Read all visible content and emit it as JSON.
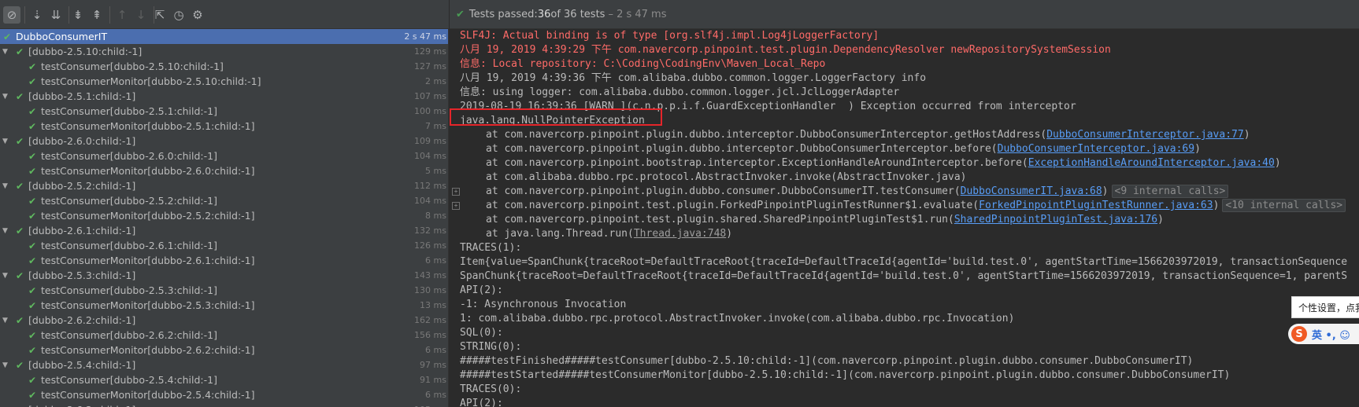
{
  "toolbar": {
    "buttons": [
      {
        "name": "show-passed-toggle",
        "icon": "⊘",
        "active": true
      },
      {
        "name": "sort-alphabetically",
        "icon": "⇣"
      },
      {
        "name": "sort-by-duration",
        "icon": "⇊"
      },
      {
        "name": "expand-all",
        "icon": "⇟"
      },
      {
        "name": "collapse-all",
        "icon": "⇞"
      },
      {
        "name": "previous-failed",
        "icon": "↑",
        "disabled": true
      },
      {
        "name": "next-failed",
        "icon": "↓",
        "disabled": true
      },
      {
        "name": "export",
        "icon": "⇱"
      },
      {
        "name": "history",
        "icon": "◷"
      },
      {
        "name": "settings",
        "icon": "⚙"
      }
    ]
  },
  "status": {
    "prefix": "Tests passed: ",
    "passed": "36",
    "suffix": " of 36 tests",
    "duration": "– 2 s 47 ms"
  },
  "tree": [
    {
      "label": "DubboConsumerIT",
      "duration": "2 s 47 ms",
      "level": 0,
      "selected": true
    },
    {
      "label": "[dubbo-2.5.10:child:-1]",
      "duration": "129 ms",
      "level": 1
    },
    {
      "label": "testConsumer[dubbo-2.5.10:child:-1]",
      "duration": "127 ms",
      "level": 2
    },
    {
      "label": "testConsumerMonitor[dubbo-2.5.10:child:-1]",
      "duration": "2 ms",
      "level": 2
    },
    {
      "label": "[dubbo-2.5.1:child:-1]",
      "duration": "107 ms",
      "level": 1
    },
    {
      "label": "testConsumer[dubbo-2.5.1:child:-1]",
      "duration": "100 ms",
      "level": 2
    },
    {
      "label": "testConsumerMonitor[dubbo-2.5.1:child:-1]",
      "duration": "7 ms",
      "level": 2
    },
    {
      "label": "[dubbo-2.6.0:child:-1]",
      "duration": "109 ms",
      "level": 1
    },
    {
      "label": "testConsumer[dubbo-2.6.0:child:-1]",
      "duration": "104 ms",
      "level": 2
    },
    {
      "label": "testConsumerMonitor[dubbo-2.6.0:child:-1]",
      "duration": "5 ms",
      "level": 2
    },
    {
      "label": "[dubbo-2.5.2:child:-1]",
      "duration": "112 ms",
      "level": 1
    },
    {
      "label": "testConsumer[dubbo-2.5.2:child:-1]",
      "duration": "104 ms",
      "level": 2
    },
    {
      "label": "testConsumerMonitor[dubbo-2.5.2:child:-1]",
      "duration": "8 ms",
      "level": 2
    },
    {
      "label": "[dubbo-2.6.1:child:-1]",
      "duration": "132 ms",
      "level": 1
    },
    {
      "label": "testConsumer[dubbo-2.6.1:child:-1]",
      "duration": "126 ms",
      "level": 2
    },
    {
      "label": "testConsumerMonitor[dubbo-2.6.1:child:-1]",
      "duration": "6 ms",
      "level": 2
    },
    {
      "label": "[dubbo-2.5.3:child:-1]",
      "duration": "143 ms",
      "level": 1
    },
    {
      "label": "testConsumer[dubbo-2.5.3:child:-1]",
      "duration": "130 ms",
      "level": 2
    },
    {
      "label": "testConsumerMonitor[dubbo-2.5.3:child:-1]",
      "duration": "13 ms",
      "level": 2
    },
    {
      "label": "[dubbo-2.6.2:child:-1]",
      "duration": "162 ms",
      "level": 1
    },
    {
      "label": "testConsumer[dubbo-2.6.2:child:-1]",
      "duration": "156 ms",
      "level": 2
    },
    {
      "label": "testConsumerMonitor[dubbo-2.6.2:child:-1]",
      "duration": "6 ms",
      "level": 2
    },
    {
      "label": "[dubbo-2.5.4:child:-1]",
      "duration": "97 ms",
      "level": 1
    },
    {
      "label": "testConsumer[dubbo-2.5.4:child:-1]",
      "duration": "91 ms",
      "level": 2
    },
    {
      "label": "testConsumerMonitor[dubbo-2.5.4:child:-1]",
      "duration": "6 ms",
      "level": 2
    },
    {
      "label": "[dubbo-2.6.3:child:-1]",
      "duration": "105 ms",
      "level": 1
    }
  ],
  "console": [
    {
      "type": "err",
      "text": "SLF4J: Actual binding is of type [org.slf4j.impl.Log4jLoggerFactory]"
    },
    {
      "type": "err",
      "text": "八月 19, 2019 4:39:29 下午 com.navercorp.pinpoint.test.plugin.DependencyResolver newRepositorySystemSession"
    },
    {
      "type": "err",
      "text": "信息: Local repository: C:\\Coding\\CodingEnv\\Maven_Local_Repo"
    },
    {
      "type": "out",
      "text": "八月 19, 2019 4:39:36 下午 com.alibaba.dubbo.common.logger.LoggerFactory info"
    },
    {
      "type": "out",
      "text": "信息: using logger: com.alibaba.dubbo.common.logger.jcl.JclLoggerAdapter"
    },
    {
      "type": "out",
      "text": "2019-08-19 16:39:36 [WARN ](c.n.p.p.i.f.GuardExceptionHandler  ) Exception occurred from interceptor"
    },
    {
      "type": "out",
      "text": "java.lang.NullPointerException"
    },
    {
      "type": "trace",
      "text": "at com.navercorp.pinpoint.plugin.dubbo.interceptor.DubboConsumerInterceptor.getHostAddress(",
      "link": "DubboConsumerInterceptor.java:77",
      "after": ")"
    },
    {
      "type": "trace",
      "text": "at com.navercorp.pinpoint.plugin.dubbo.interceptor.DubboConsumerInterceptor.before(",
      "link": "DubboConsumerInterceptor.java:69",
      "after": ")"
    },
    {
      "type": "trace",
      "text": "at com.navercorp.pinpoint.bootstrap.interceptor.ExceptionHandleAroundInterceptor.before(",
      "link": "ExceptionHandleAroundInterceptor.java:40",
      "after": ")"
    },
    {
      "type": "trace",
      "text": "at com.alibaba.dubbo.rpc.protocol.AbstractInvoker.invoke(AbstractInvoker.java)"
    },
    {
      "type": "trace",
      "fold": true,
      "text": "at com.navercorp.pinpoint.plugin.dubbo.consumer.DubboConsumerIT.testConsumer(",
      "link": "DubboConsumerIT.java:68",
      "after": ")",
      "pill": "<9 internal calls>"
    },
    {
      "type": "trace",
      "fold": true,
      "text": "at com.navercorp.pinpoint.test.plugin.ForkedPinpointPluginTestRunner$1.evaluate(",
      "link": "ForkedPinpointPluginTestRunner.java:63",
      "after": ")",
      "pill": "<10 internal calls>"
    },
    {
      "type": "trace",
      "text": "at com.navercorp.pinpoint.test.plugin.shared.SharedPinpointPluginTest$1.run(",
      "link": "SharedPinpointPluginTest.java:176",
      "after": ")"
    },
    {
      "type": "trace",
      "text": "at java.lang.Thread.run(",
      "link": "Thread.java:748",
      "after": ")",
      "gray": true
    },
    {
      "type": "out",
      "text": "TRACES(1):"
    },
    {
      "type": "out",
      "text": "Item{value=SpanChunk{traceRoot=DefaultTraceRoot{traceId=DefaultTraceId{agentId='build.test.0', agentStartTime=1566203972019, transactionSequence"
    },
    {
      "type": "out",
      "text": "SpanChunk{traceRoot=DefaultTraceRoot{traceId=DefaultTraceId{agentId='build.test.0', agentStartTime=1566203972019, transactionSequence=1, parentS"
    },
    {
      "type": "out",
      "text": "API(2):"
    },
    {
      "type": "out",
      "text": "-1: Asynchronous Invocation"
    },
    {
      "type": "out",
      "text": "1: com.alibaba.dubbo.rpc.protocol.AbstractInvoker.invoke(com.alibaba.dubbo.rpc.Invocation)"
    },
    {
      "type": "out",
      "text": "SQL(0):"
    },
    {
      "type": "out",
      "text": "STRING(0):"
    },
    {
      "type": "out",
      "text": "#####testFinished#####testConsumer[dubbo-2.5.10:child:-1](com.navercorp.pinpoint.plugin.dubbo.consumer.DubboConsumerIT)"
    },
    {
      "type": "out",
      "text": "#####testStarted#####testConsumerMonitor[dubbo-2.5.10:child:-1](com.navercorp.pinpoint.plugin.dubbo.consumer.DubboConsumerIT)"
    },
    {
      "type": "out",
      "text": "TRACES(0):"
    },
    {
      "type": "out",
      "text": "API(2):"
    }
  ],
  "ime": {
    "tooltip": "个性设置，点我",
    "logo": "S",
    "text": "英 •, ☺"
  }
}
